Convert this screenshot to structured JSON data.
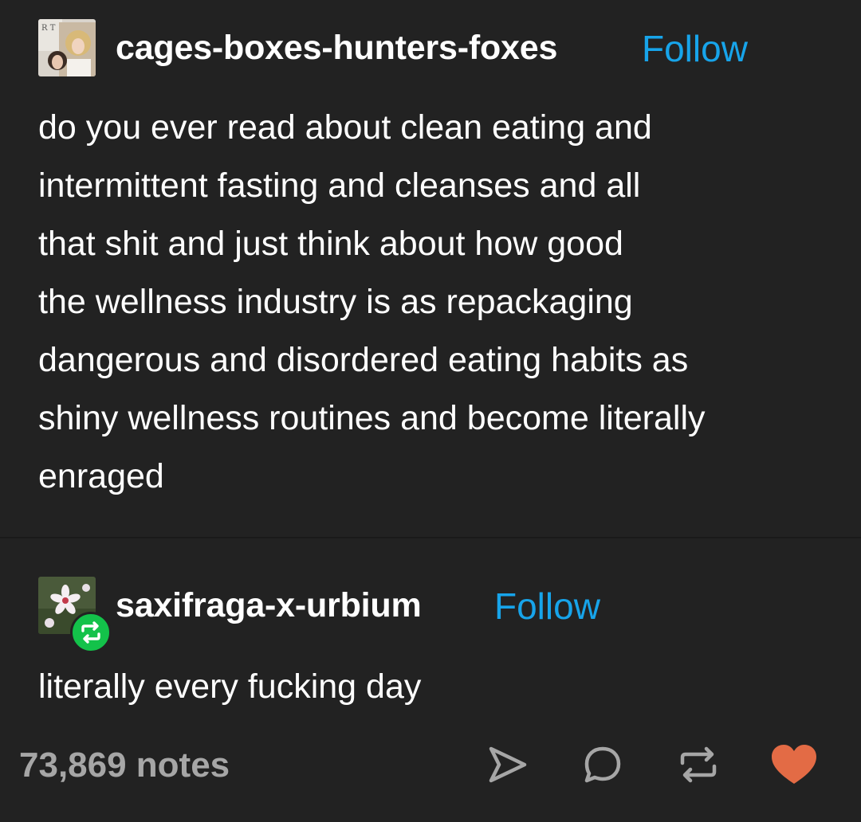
{
  "post": {
    "author": "cages-boxes-hunters-foxes",
    "follow_label": "Follow",
    "body_lines": [
      "do you ever read about clean eating and",
      "intermittent fasting and cleanses and all",
      "that shit and just think about how good",
      "the wellness industry is as repackaging",
      "dangerous and disordered eating habits as",
      "shiny wellness routines and become literally",
      "enraged"
    ]
  },
  "reblog": {
    "author": "saxifraga-x-urbium",
    "follow_label": "Follow",
    "body": "literally every fucking day",
    "badge_icon": "reblog-icon"
  },
  "footer": {
    "notes": "73,869 notes",
    "actions": [
      "share-icon",
      "reply-icon",
      "reblog-icon",
      "like-icon"
    ]
  },
  "colors": {
    "background": "#222222",
    "follow": "#17a4ea",
    "like": "#e36b45",
    "reblog_badge": "#13c24a",
    "muted": "#a6a6a6"
  }
}
